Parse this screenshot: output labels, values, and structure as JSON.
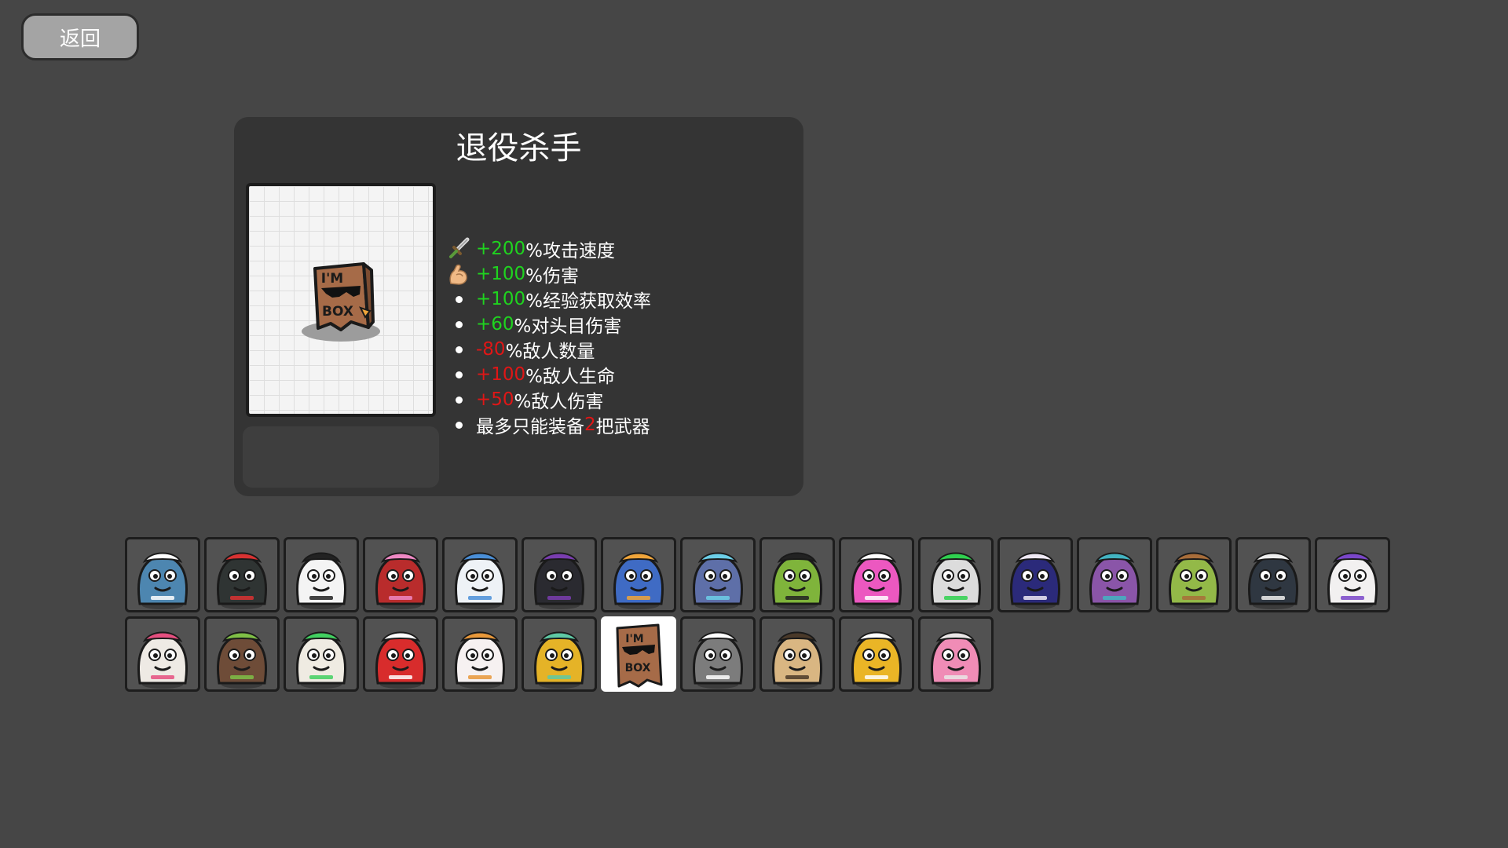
{
  "back_button": {
    "label": "返回"
  },
  "character": {
    "name": "退役杀手",
    "stats": [
      {
        "icon": "sword-icon",
        "value": "+200",
        "value_color": "green",
        "text": "%攻击速度"
      },
      {
        "icon": "flexed-arm-icon",
        "value": "+100",
        "value_color": "green",
        "text": "%伤害"
      },
      {
        "icon": "bullet",
        "value": "+100",
        "value_color": "green",
        "text": "%经验获取效率"
      },
      {
        "icon": "bullet",
        "value": "+60",
        "value_color": "green",
        "text": "%对头目伤害"
      },
      {
        "icon": "bullet",
        "value": "-80",
        "value_color": "red",
        "text": "%敌人数量"
      },
      {
        "icon": "bullet",
        "value": "+100",
        "value_color": "red",
        "text": "%敌人生命"
      },
      {
        "icon": "bullet",
        "value": "+50",
        "value_color": "red",
        "text": "%敌人伤害"
      },
      {
        "icon": "bullet",
        "prefix": "最多只能装备",
        "value": "2",
        "value_color": "red",
        "text": "把武器"
      }
    ],
    "portrait_box_text": [
      "I'M",
      "BOX"
    ]
  },
  "colors": {
    "positive": "#1fd41f",
    "negative": "#e01616",
    "background": "#464646",
    "panel": "#343434"
  },
  "roster": {
    "selected_index": 22,
    "characters": [
      {
        "icon": "blue-feathered-monster-icon",
        "body": "#4d86b0",
        "accent": "#ffffff"
      },
      {
        "icon": "ninja-crow-icon",
        "body": "#2f3433",
        "accent": "#d93232"
      },
      {
        "icon": "ghost-icon",
        "body": "#f4f4f4",
        "accent": "#222222"
      },
      {
        "icon": "gumball-machine-icon",
        "body": "#b92c2c",
        "accent": "#ee88c4"
      },
      {
        "icon": "winter-hat-snowman-icon",
        "body": "#eef2f6",
        "accent": "#4a8fd8"
      },
      {
        "icon": "magician-rabbit-icon",
        "body": "#2a2a30",
        "accent": "#7a3db0"
      },
      {
        "icon": "diver-helmet-icon",
        "body": "#3f6bc4",
        "accent": "#f0a53a"
      },
      {
        "icon": "ufo-alien-icon",
        "body": "#5e6fa8",
        "accent": "#6ccfe8"
      },
      {
        "icon": "green-fuzzball-icon",
        "body": "#7fb43b",
        "accent": "#222222"
      },
      {
        "icon": "pink-slime-icon",
        "body": "#ec58c0",
        "accent": "#ffffff"
      },
      {
        "icon": "retro-computer-icon",
        "body": "#dcdcdc",
        "accent": "#2fd14f"
      },
      {
        "icon": "space-astronaut-icon",
        "body": "#2b2a7a",
        "accent": "#efe9f5"
      },
      {
        "icon": "purple-bear-icon",
        "body": "#8a55a8",
        "accent": "#42b4c2"
      },
      {
        "icon": "cowboy-cactus-icon",
        "body": "#93b948",
        "accent": "#a86d3a"
      },
      {
        "icon": "secret-agent-penguin-icon",
        "body": "#2f3741",
        "accent": "#eeeeee"
      },
      {
        "icon": "goggles-bunny-icon",
        "body": "#f2f0f0",
        "accent": "#7a46c9"
      },
      {
        "icon": "heart-glasses-sheep-icon",
        "body": "#eeeae4",
        "accent": "#e54f7f"
      },
      {
        "icon": "coconut-icon",
        "body": "#6e4c38",
        "accent": "#7fbf46"
      },
      {
        "icon": "mummy-icon",
        "body": "#efebe2",
        "accent": "#41d060"
      },
      {
        "icon": "red-devil-icon",
        "body": "#d82c2c",
        "accent": "#ffffff"
      },
      {
        "icon": "party-ghost-icon",
        "body": "#f6f1f1",
        "accent": "#e8983a"
      },
      {
        "icon": "yellow-hazmat-icon",
        "body": "#e5b327",
        "accent": "#5ec9a4"
      },
      {
        "icon": "box-head-icon",
        "body": "#a66b48",
        "accent": "#1a1a1a"
      },
      {
        "icon": "gray-tabby-cat-icon",
        "body": "#7c7c7c",
        "accent": "#ffffff"
      },
      {
        "icon": "pug-dog-icon",
        "body": "#d9b682",
        "accent": "#4a3929"
      },
      {
        "icon": "yellow-octopus-icon",
        "body": "#eab526",
        "accent": "#ffffff"
      },
      {
        "icon": "pink-bird-icon",
        "body": "#f08cb6",
        "accent": "#e9e6e6"
      }
    ]
  }
}
